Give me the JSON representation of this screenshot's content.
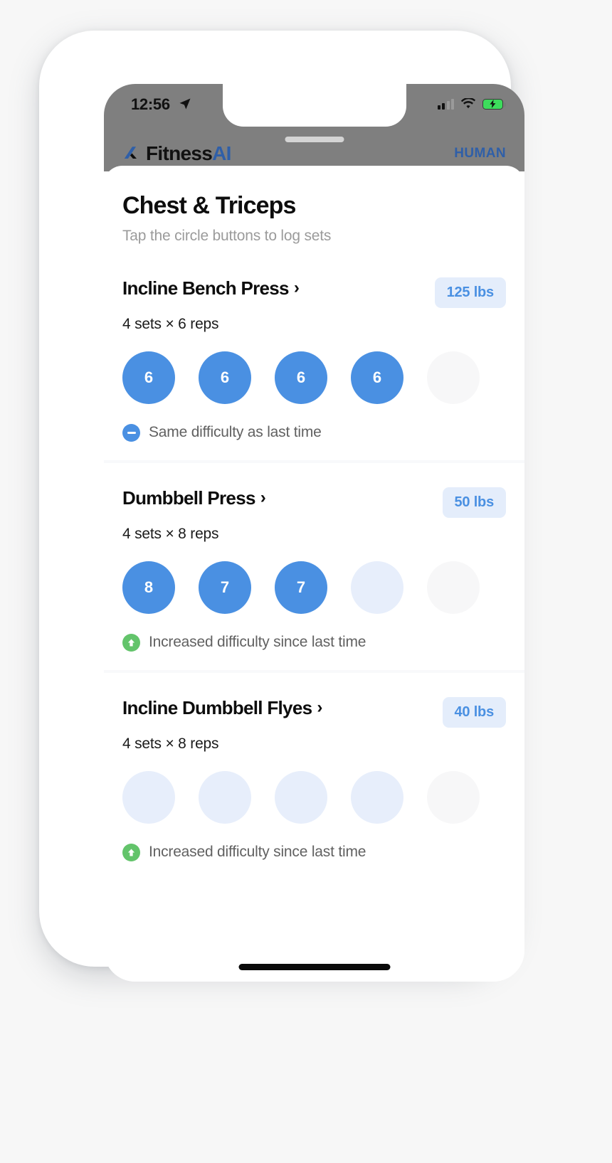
{
  "status_bar": {
    "time": "12:56",
    "location_icon": "location-arrow-icon",
    "signal_icon": "cellular-signal-icon",
    "wifi_icon": "wifi-icon",
    "battery_icon": "battery-charging-icon"
  },
  "app_header": {
    "logo_icon": "fitnessai-logo-icon",
    "brand_primary": "Fitness",
    "brand_accent": "AI",
    "right_label": "HUMAN",
    "drag_handle": "drag-handle"
  },
  "page": {
    "title": "Chest & Triceps",
    "subtitle": "Tap the circle buttons to log sets"
  },
  "colors": {
    "accent_blue": "#4a90e2",
    "badge_bg": "#e4edfb",
    "pending_circle": "#e7eefb",
    "extra_circle": "#f7f7f8",
    "green": "#63c46b",
    "brand_blue": "#2f5fa8",
    "header_gray": "#7f7f7f"
  },
  "exercises": [
    {
      "name": "Incline Bench Press",
      "chevron": "›",
      "weight": "125 lbs",
      "meta": "4 sets × 6 reps",
      "sets": [
        {
          "value": "6",
          "state": "done"
        },
        {
          "value": "6",
          "state": "done"
        },
        {
          "value": "6",
          "state": "done"
        },
        {
          "value": "6",
          "state": "done"
        },
        {
          "value": "",
          "state": "extra"
        }
      ],
      "difficulty": {
        "icon": "minus-circle-icon",
        "type": "same",
        "text": "Same difficulty as last time"
      }
    },
    {
      "name": "Dumbbell Press",
      "chevron": "›",
      "weight": "50 lbs",
      "meta": "4 sets × 8 reps",
      "sets": [
        {
          "value": "8",
          "state": "done"
        },
        {
          "value": "7",
          "state": "done"
        },
        {
          "value": "7",
          "state": "done"
        },
        {
          "value": "",
          "state": "pending"
        },
        {
          "value": "",
          "state": "extra"
        }
      ],
      "difficulty": {
        "icon": "arrow-up-circle-icon",
        "type": "up",
        "text": "Increased difficulty since last time"
      }
    },
    {
      "name": "Incline Dumbbell Flyes",
      "chevron": "›",
      "weight": "40 lbs",
      "meta": "4 sets × 8 reps",
      "sets": [
        {
          "value": "",
          "state": "pending"
        },
        {
          "value": "",
          "state": "pending"
        },
        {
          "value": "",
          "state": "pending"
        },
        {
          "value": "",
          "state": "pending"
        },
        {
          "value": "",
          "state": "extra"
        }
      ],
      "difficulty": {
        "icon": "arrow-up-circle-icon",
        "type": "up",
        "text": "Increased difficulty since last time"
      }
    }
  ]
}
